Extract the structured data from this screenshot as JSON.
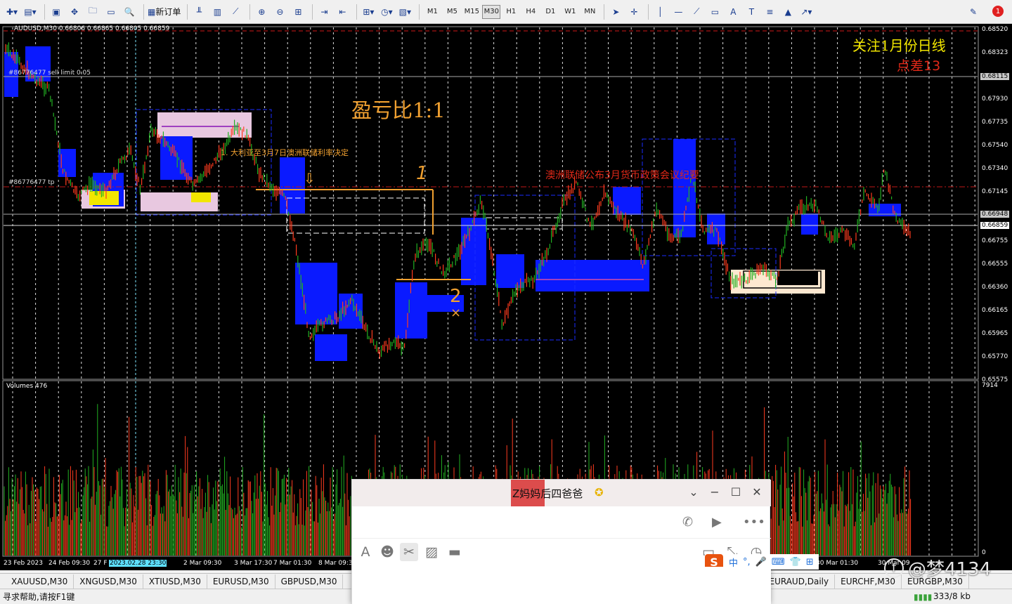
{
  "toolbar": {
    "new_order_label": "新订单",
    "timeframes": [
      "M1",
      "M5",
      "M15",
      "M30",
      "H1",
      "H4",
      "D1",
      "W1",
      "MN"
    ],
    "active_timeframe": "M30",
    "alert_count": "1"
  },
  "chart": {
    "header": "AUDUSD,M30  0.66806 0.66865 0.66805 0.66859",
    "order_label_1": "#86776477 sell limit 0.05",
    "order_label_2": "#86776477 tp",
    "ratio_text": "盈亏比1:1",
    "note_1": "1. 大利亚至3月7日澳洲联储利率决定",
    "note_2": "澳洲联储公布3月货币政策会议纪要",
    "corner_line_1": "关注1月份日线",
    "corner_line_2": "点差13",
    "mark_1": "1",
    "mark_2": "2",
    "mark_x": "×",
    "arrow_down": "⇩",
    "volume_label": "Volumes 476",
    "volume_scale_top": "7914",
    "volume_scale_bottom": "0",
    "price_ticks": [
      "0.68520",
      "0.68323",
      "0.68115",
      "0.67930",
      "0.67735",
      "0.67540",
      "0.67340",
      "0.67145",
      "0.66948",
      "0.66859",
      "0.66755",
      "0.66555",
      "0.66360",
      "0.66165",
      "0.65965",
      "0.65770",
      "0.65575"
    ],
    "price_highlight_1": "0.66948",
    "price_highlight_2": "0.66859",
    "price_highlight_3": "0.68115",
    "time_ticks": [
      "23 Feb 2023",
      "24 Feb 09:30",
      "27 F",
      "2023.02.28 23:30",
      "2 Mar 09:30",
      "3 Mar 17:30",
      "7 Mar 01:30",
      "8 Mar 09:30",
      "30 Mar 01:30",
      "30 Mar 09"
    ],
    "colors": {
      "background": "#000000",
      "bull_candle": "#22b022",
      "bear_candle": "#ff3b1f",
      "zone_blue": "#0a1aff",
      "zone_pink": "#e8c8e0",
      "zone_yellow": "#f2e600",
      "zone_cream": "#fde8d0",
      "annotation_orange": "#f0a030",
      "annotation_red": "#e02818"
    }
  },
  "symbol_tabs": [
    "XAUUSD,M30",
    "XNGUSD,M30",
    "XTIUSD,M30",
    "EURUSD,M30",
    "GBPUSD,M30",
    "EURAUD,Daily",
    "EURCHF,M30",
    "EURGBP,M30"
  ],
  "status_bar": {
    "help_text": "寻求帮助,请按F1键",
    "traffic": "333/8 kb"
  },
  "chat": {
    "title": "Z妈妈后四爸爸",
    "ime_lang": "中"
  },
  "watermark": "@梦4134"
}
